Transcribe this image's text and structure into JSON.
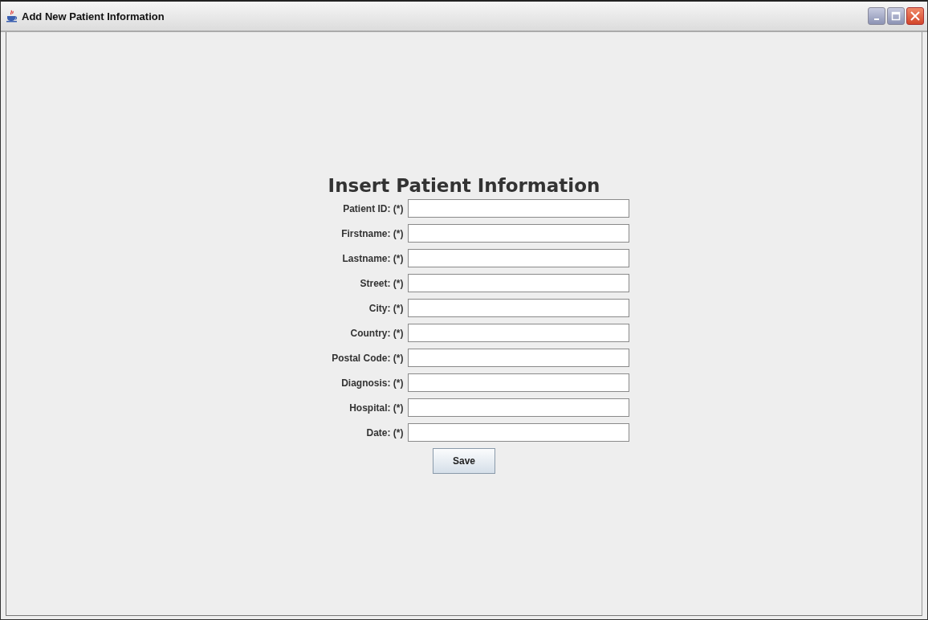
{
  "window": {
    "title": "Add New Patient Information"
  },
  "form": {
    "heading": "Insert Patient Information",
    "fields": [
      {
        "label": "Patient ID: (*)"
      },
      {
        "label": "Firstname: (*)"
      },
      {
        "label": "Lastname: (*)"
      },
      {
        "label": "Street: (*)"
      },
      {
        "label": "City: (*)"
      },
      {
        "label": "Country: (*)"
      },
      {
        "label": "Postal Code: (*)"
      },
      {
        "label": "Diagnosis: (*)"
      },
      {
        "label": "Hospital: (*)"
      },
      {
        "label": "Date: (*)"
      }
    ],
    "buttons": [
      "Save"
    ]
  }
}
